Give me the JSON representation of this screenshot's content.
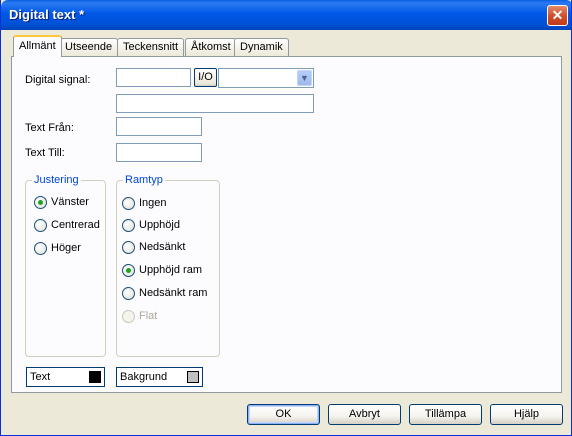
{
  "window": {
    "title": "Digital text *"
  },
  "tabs": [
    {
      "label": "Allmänt",
      "active": true
    },
    {
      "label": "Utseende"
    },
    {
      "label": "Teckensnitt"
    },
    {
      "label": "Åtkomst"
    },
    {
      "label": "Dynamik"
    }
  ],
  "form": {
    "digital_signal_label": "Digital signal:",
    "digital_signal_value": "",
    "io_button_label": "I/O",
    "io_select_value": "",
    "signal_description_value": "",
    "text_from_label": "Text Från:",
    "text_from_value": "",
    "text_to_label": "Text Till:",
    "text_to_value": ""
  },
  "justification": {
    "title": "Justering",
    "options": [
      {
        "label": "Vänster",
        "checked": true
      },
      {
        "label": "Centrerad",
        "checked": false
      },
      {
        "label": "Höger",
        "checked": false
      }
    ]
  },
  "frame_type": {
    "title": "Ramtyp",
    "options": [
      {
        "label": "Ingen",
        "checked": false
      },
      {
        "label": "Upphöjd",
        "checked": false
      },
      {
        "label": "Nedsänkt",
        "checked": false
      },
      {
        "label": "Upphöjd ram",
        "checked": true
      },
      {
        "label": "Nedsänkt ram",
        "checked": false
      },
      {
        "label": "Flat",
        "checked": false,
        "disabled": true
      }
    ]
  },
  "colors": {
    "text_label": "Text",
    "text_color": "#000000",
    "background_label": "Bakgrund",
    "background_color": "#c0c0c0"
  },
  "buttons": {
    "ok": "OK",
    "cancel": "Avbryt",
    "apply": "Tillämpa",
    "help": "Hjälp"
  }
}
